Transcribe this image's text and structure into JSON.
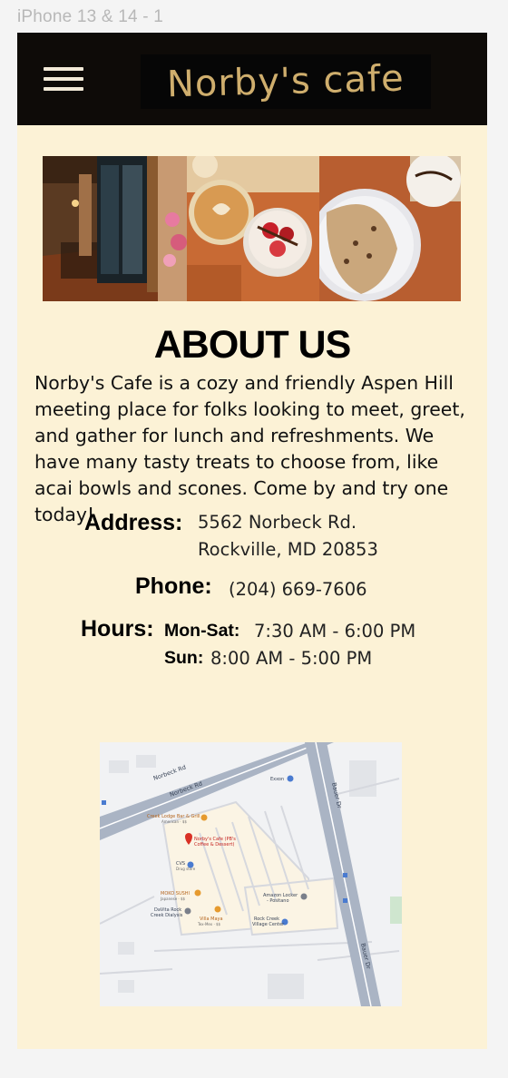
{
  "frame_label": "iPhone 13 & 14 - 1",
  "header": {
    "menu_icon": "hamburger-menu-icon",
    "logo_text": "Norby's cafe",
    "logo_color": "#cfae6d",
    "background": "#0e0b08"
  },
  "hero": {
    "photos": [
      "cafe-interior-photo",
      "coffee-and-acai-photo",
      "scone-photo"
    ]
  },
  "about": {
    "title": "ABOUT US",
    "body": "Norby's Cafe is a cozy and friendly Aspen Hill meeting place for folks looking to meet, greet, and gather for lunch and refreshments. We have many tasty treats to choose from, like acai bowls and scones. Come by and try one today!"
  },
  "contact": {
    "address_label": "Address:",
    "address_line1": "5562 Norbeck Rd.",
    "address_line2": "Rockville, MD 20853",
    "phone_label": "Phone:",
    "phone_value": "(204) 669-7606",
    "hours_label": "Hours:",
    "hours": [
      {
        "day": "Mon-Sat:",
        "time": "7:30 AM - 6:00 PM"
      },
      {
        "day": "Sun:",
        "time": "8:00 AM - 5:00 PM"
      }
    ]
  },
  "map": {
    "roads": [
      "Norbeck Rd",
      "Norbeck Rd",
      "Bauer Dr",
      "Bauer Dr"
    ],
    "places": [
      {
        "name": "Creek Lodge Bar & Grill",
        "sub": "American · $$"
      },
      {
        "name": "Norby's Cafe (PB's",
        "sub": "Coffee & Dessert)"
      },
      {
        "name": "CVS",
        "sub": "Drug store"
      },
      {
        "name": "MOKO SUSHI",
        "sub": "Japanese · $$"
      },
      {
        "name": "DaVita Rock",
        "sub": "Creek Dialysis"
      },
      {
        "name": "Villa Maya",
        "sub": "Tex-Mex · $$"
      },
      {
        "name": "Amazon Locker",
        "sub": "- Positano"
      },
      {
        "name": "Rock Creek",
        "sub": "Village Center"
      },
      {
        "name": "Exxon",
        "sub": ""
      }
    ],
    "pin_color": "#d93025"
  },
  "colors": {
    "page_bg": "#fcf2d6",
    "canvas_bg": "#f4f4f4"
  }
}
